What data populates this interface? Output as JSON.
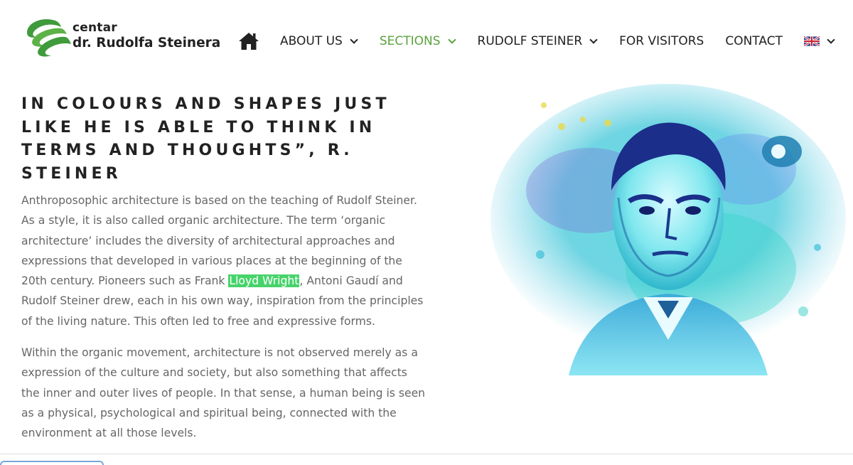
{
  "header": {
    "logo": {
      "line1": "centar",
      "line2": "dr. Rudolfa Steinera",
      "brand_color": "#3f9b3b"
    },
    "nav": {
      "home_icon": "home-icon",
      "items": [
        {
          "label": "ABOUT US",
          "has_dropdown": true,
          "active": false
        },
        {
          "label": "SECTIONS",
          "has_dropdown": true,
          "active": true
        },
        {
          "label": "RUDOLF STEINER",
          "has_dropdown": true,
          "active": false
        },
        {
          "label": "FOR VISITORS",
          "has_dropdown": false,
          "active": false
        },
        {
          "label": "CONTACT",
          "has_dropdown": false,
          "active": false
        }
      ],
      "language_icon": "uk-flag-icon",
      "active_color": "#5aa33c"
    }
  },
  "main": {
    "heading": "IN COLOURS AND SHAPES JUST LIKE HE IS ABLE TO THINK IN TERMS AND THOUGHTS”, R. STEINER",
    "paragraph1": {
      "before": "Anthroposophic architecture is based on the teaching of Rudolf Steiner. As a style, it is also called organic architecture. The term ‘organic architecture’ includes the diversity of architectural approaches and expressions that developed in various places at the beginning of the 20th century. Pioneers such as Frank ",
      "highlighted": "Lloyd Wright",
      "after": ", Antoni Gaudí and Rudolf Steiner drew, each in his own way, inspiration from the principles of the living nature. This often led to free and expressive forms."
    },
    "paragraph2": "Within the organic movement, architecture is not observed merely as a expression of the culture and society, but also something that affects the inner and outer lives of people. In that sense, a human being is seen as a physical, psychological and spiritual being, connected with the environment at all those levels.",
    "highlight_color": "#47d36b"
  }
}
